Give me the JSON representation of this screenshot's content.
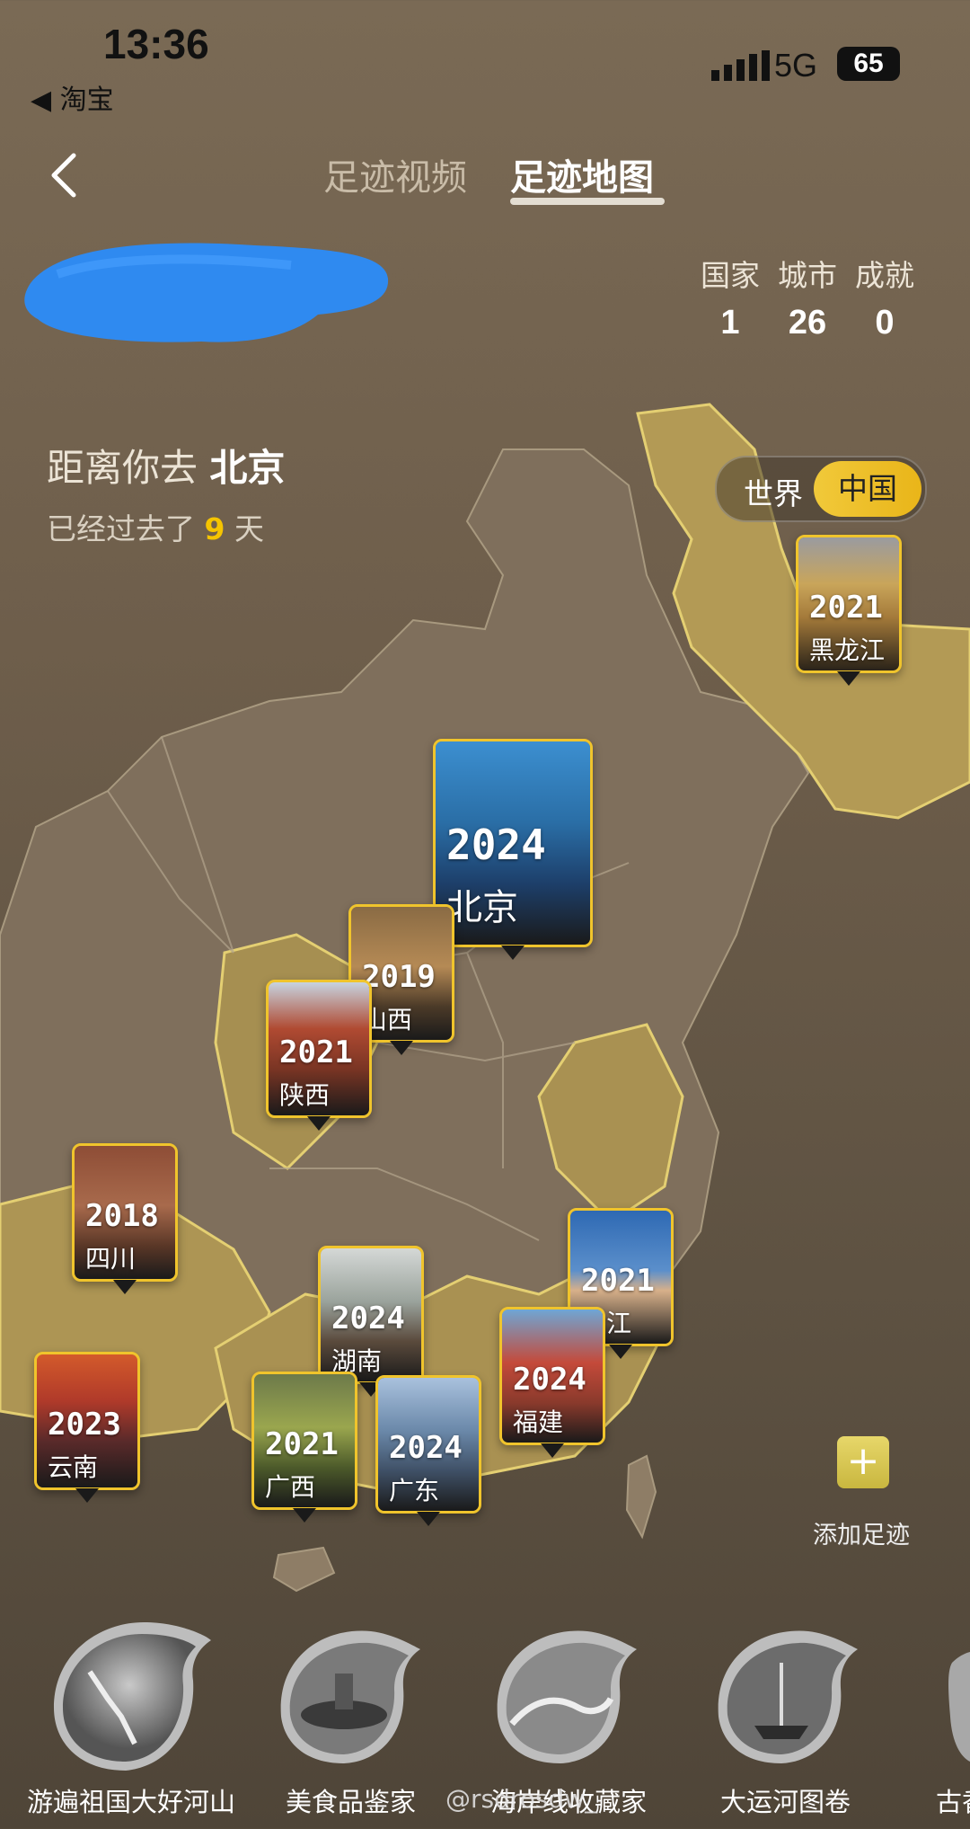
{
  "status": {
    "time": "13:36",
    "back_app": "◀ 淘宝",
    "network": "5G",
    "battery": "65"
  },
  "tabs": [
    {
      "label": "足迹视频"
    },
    {
      "label": "足迹地图"
    }
  ],
  "stats": [
    {
      "label": "国家",
      "value": "1"
    },
    {
      "label": "城市",
      "value": "26"
    },
    {
      "label": "成就",
      "value": "0"
    }
  ],
  "distance": {
    "prefix": "距离你去",
    "city": "北京",
    "days_prefix": "已经过去了",
    "days": "9",
    "days_suffix": "天"
  },
  "map_switch": {
    "world": "世界",
    "china": "中国"
  },
  "pins": [
    {
      "year": "2021",
      "name": "黑龙江"
    },
    {
      "year": "2024",
      "name": "北京"
    },
    {
      "year": "2019",
      "name": "山西"
    },
    {
      "year": "2021",
      "name": "陕西"
    },
    {
      "year": "2018",
      "name": "四川"
    },
    {
      "year": "2021",
      "name": "浙江"
    },
    {
      "year": "2024",
      "name": "湖南"
    },
    {
      "year": "2024",
      "name": "福建"
    },
    {
      "year": "2023",
      "name": "云南"
    },
    {
      "year": "2021",
      "name": "广西"
    },
    {
      "year": "2024",
      "name": "广东"
    }
  ],
  "add_footprint": {
    "label": "添加足迹",
    "icon": "plus-icon"
  },
  "badges": [
    {
      "label": "游遍祖国大好河山",
      "icon": "great-wall-icon"
    },
    {
      "label": "美食品鉴家",
      "icon": "hotpot-icon"
    },
    {
      "label": "海岸线收藏家",
      "icon": "wave-icon"
    },
    {
      "label": "大运河图卷",
      "icon": "ship-icon"
    },
    {
      "label": "古香",
      "icon": "partial-badge-icon"
    }
  ],
  "watermark": "@rsdrosdw_",
  "colors": {
    "accent": "#f0c42c",
    "visited_region": "#b39a55",
    "unvisited_region": "#7d6d5a"
  }
}
